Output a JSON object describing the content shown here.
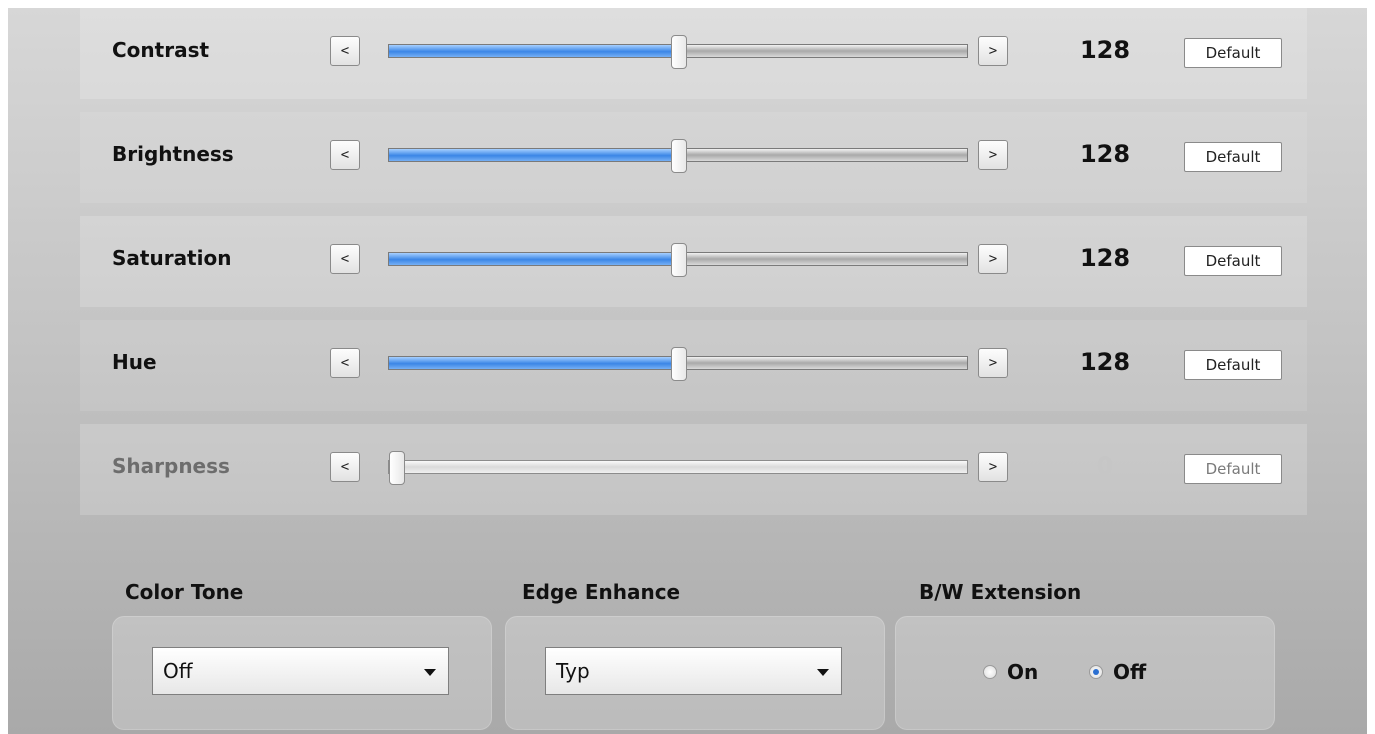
{
  "sliders": [
    {
      "label": "Contrast",
      "value": "128",
      "position": 128,
      "max": 255,
      "enabled": true,
      "default_label": "Default"
    },
    {
      "label": "Brightness",
      "value": "128",
      "position": 128,
      "max": 255,
      "enabled": true,
      "default_label": "Default"
    },
    {
      "label": "Saturation",
      "value": "128",
      "position": 128,
      "max": 255,
      "enabled": true,
      "default_label": "Default"
    },
    {
      "label": "Hue",
      "value": "128",
      "position": 128,
      "max": 255,
      "enabled": true,
      "default_label": "Default"
    },
    {
      "label": "Sharpness",
      "value": "0",
      "position": 0,
      "max": 255,
      "enabled": false,
      "default_label": "Default"
    }
  ],
  "step_buttons": {
    "decrement": "<",
    "increment": ">"
  },
  "color_tone": {
    "title": "Color Tone",
    "selected": "Off"
  },
  "edge_enhance": {
    "title": "Edge Enhance",
    "selected": "Typ"
  },
  "bw_extension": {
    "title": "B/W Extension",
    "on_label": "On",
    "off_label": "Off",
    "selected": "Off"
  },
  "colors": {
    "fill_blue": "#3b86e6",
    "panel_top": "#d7d7d7",
    "panel_bottom": "#a9a9a9",
    "disabled_text": "#6d6d6d"
  }
}
